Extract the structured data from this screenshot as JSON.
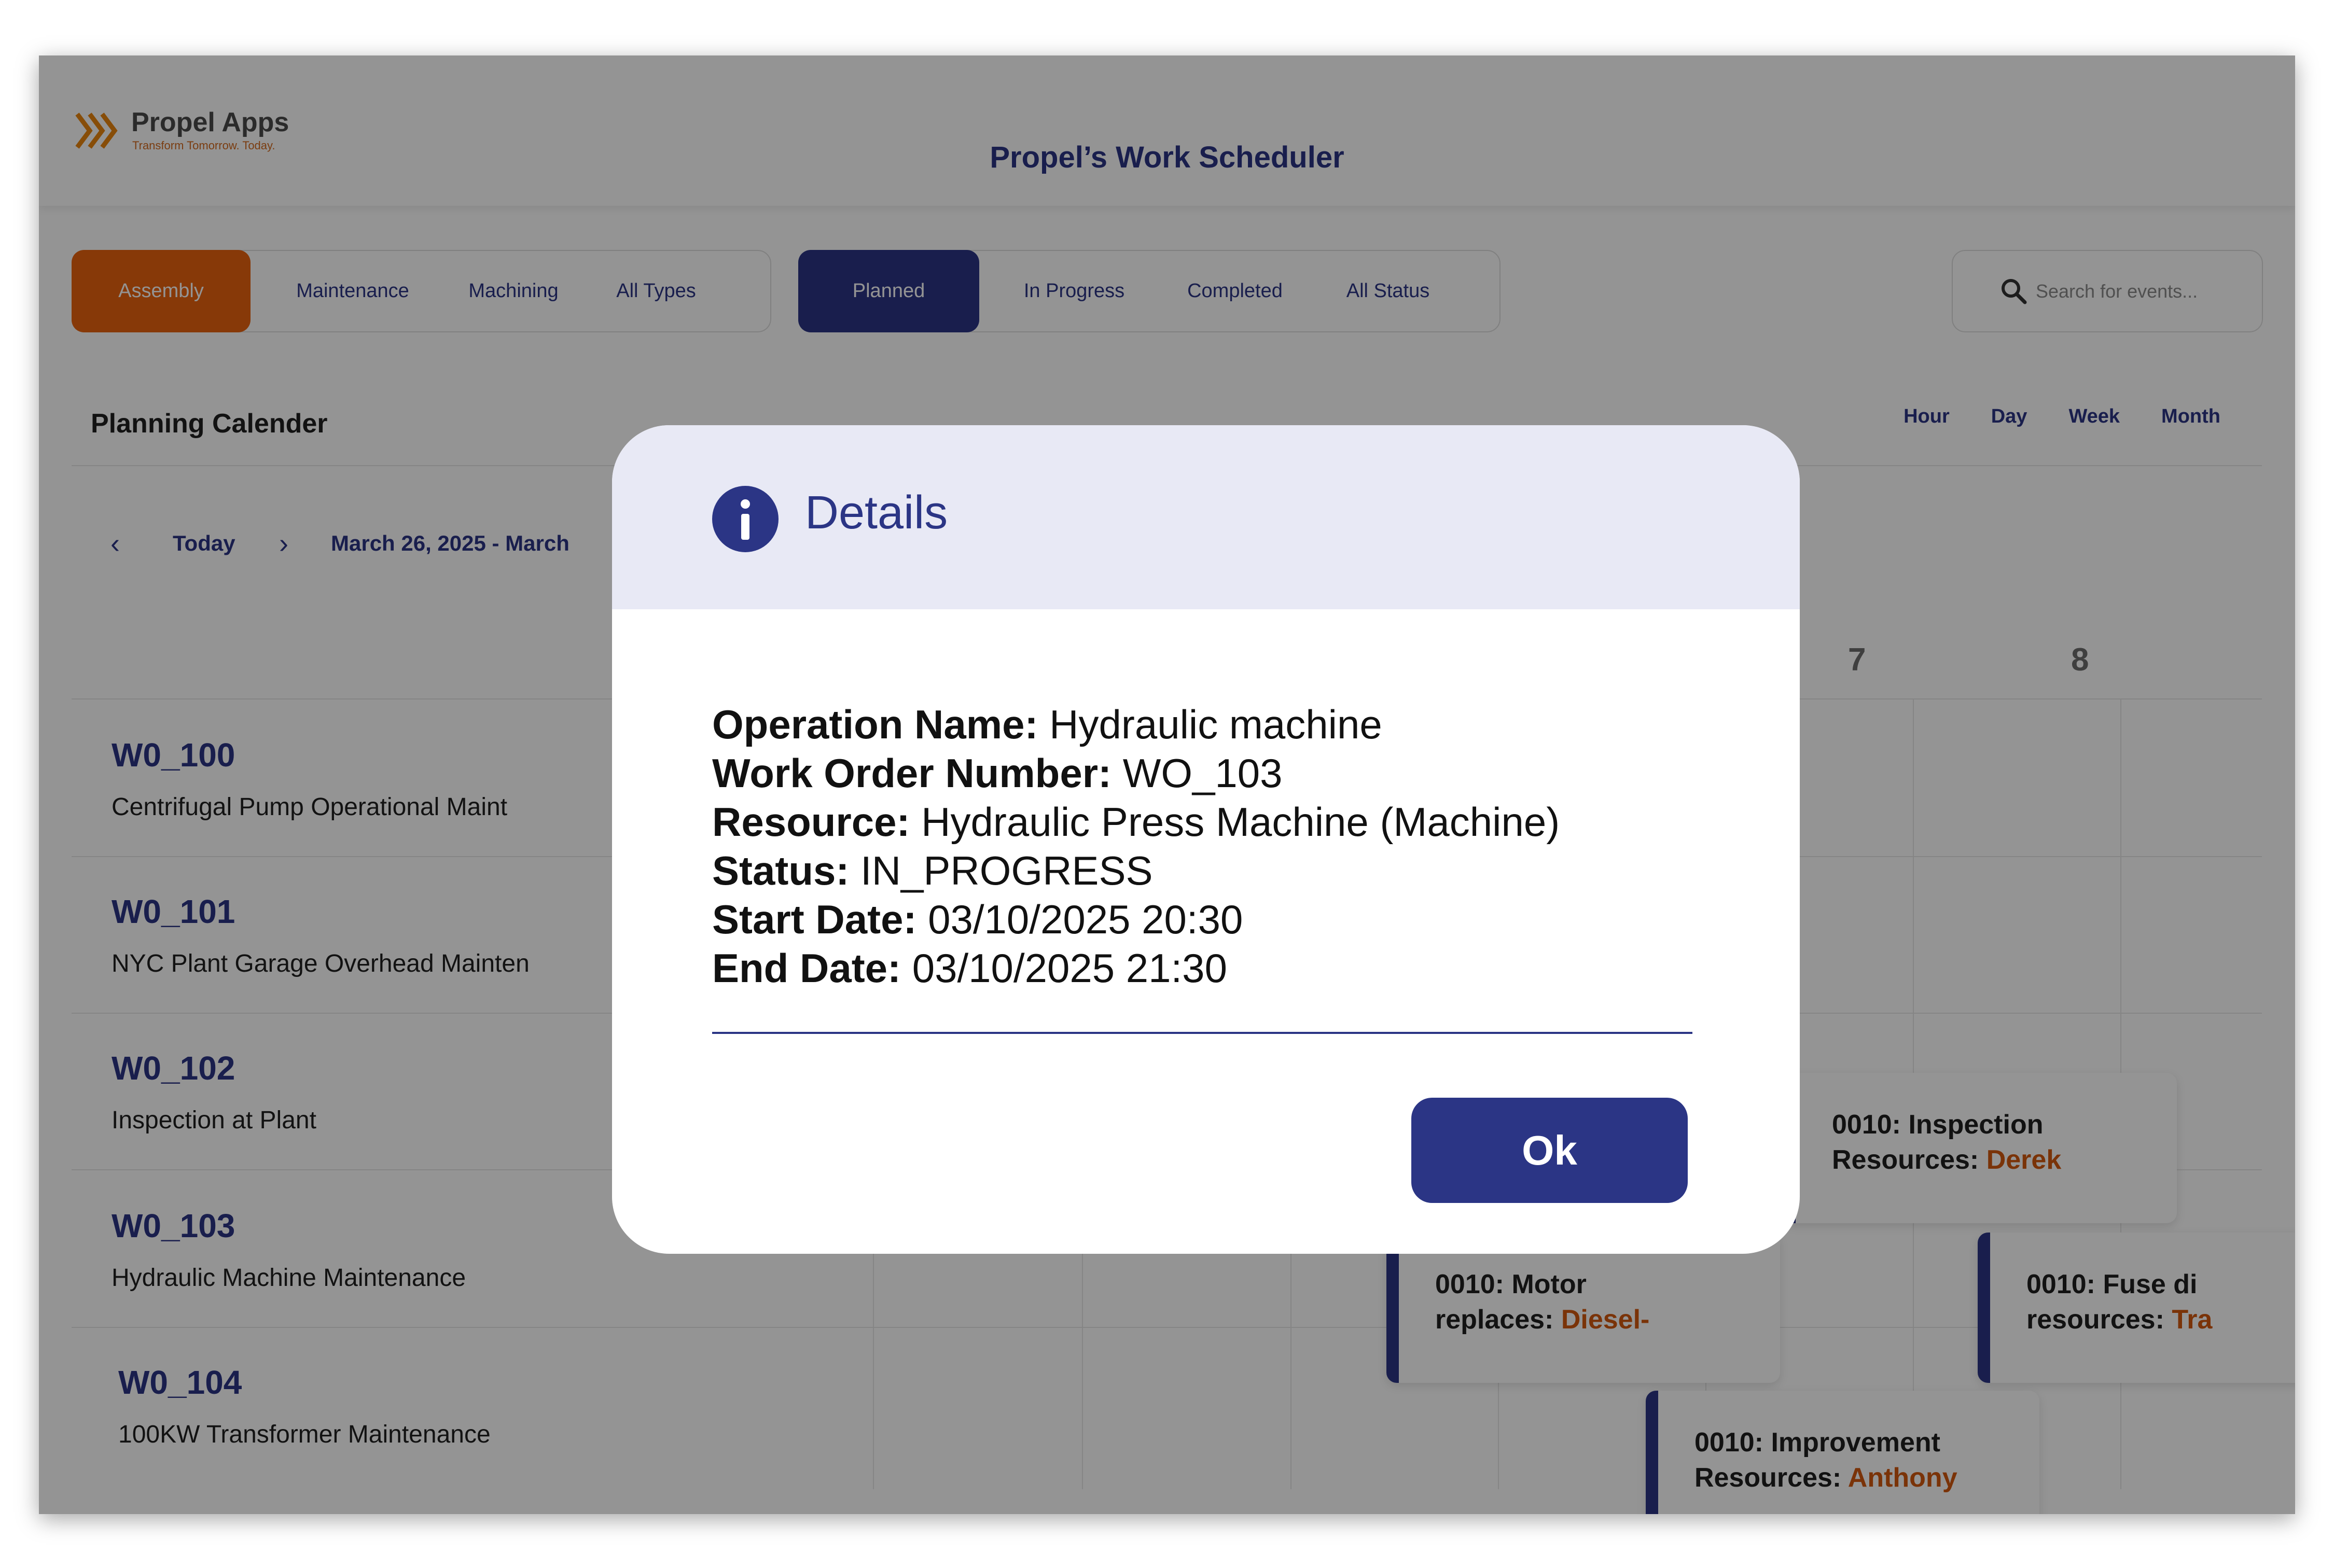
{
  "header": {
    "logo_title": "Propel Apps",
    "logo_tagline": "Transform Tomorrow. Today.",
    "app_title": "Propel’s Work Scheduler"
  },
  "type_filter": {
    "options": [
      "Assembly",
      "Maintenance",
      "Machining",
      "All Types"
    ],
    "active": "Assembly",
    "active_color": "#e8620f"
  },
  "status_filter": {
    "options": [
      "Planned",
      "In Progress",
      "Completed",
      "All Status"
    ],
    "active": "Planned",
    "active_color": "#2b3585"
  },
  "search": {
    "placeholder": "Search for events..."
  },
  "calendar": {
    "title": "Planning Calender",
    "views": [
      "Hour",
      "Day",
      "Week",
      "Month"
    ],
    "nav": {
      "today": "Today",
      "range": "March 26, 2025 - March"
    },
    "day_numbers": [
      "7",
      "8"
    ],
    "rows": [
      {
        "code": "W0_100",
        "name": "Centrifugal Pump Operational Maint"
      },
      {
        "code": "W0_101",
        "name": "NYC Plant Garage Overhead Mainten"
      },
      {
        "code": "W0_102",
        "name": "Inspection at Plant"
      },
      {
        "code": "W0_103",
        "name": "Hydraulic Machine Maintenance"
      },
      {
        "code": "W0_104",
        "name": "100KW Transformer Maintenance"
      }
    ],
    "events": [
      {
        "line1": "0010: Inspection",
        "label": "Resources:",
        "resource": "Derek"
      },
      {
        "line1": "0010: Motor",
        "label": "replaces:",
        "resource": "Diesel-"
      },
      {
        "line1": "0010: Fuse di",
        "label": "resources:",
        "resource": "Tra"
      },
      {
        "line1": "0010: Improvement",
        "label": "Resources:",
        "resource": "Anthony"
      }
    ]
  },
  "modal": {
    "title": "Details",
    "fields": [
      {
        "label": "Operation Name:",
        "value": "Hydraulic machine"
      },
      {
        "label": "Work Order Number:",
        "value": "WO_103"
      },
      {
        "label": "Resource:",
        "value": "Hydraulic Press Machine (Machine)"
      },
      {
        "label": "Status:",
        "value": "IN_PROGRESS"
      },
      {
        "label": "Start Date:",
        "value": "03/10/2025 20:30"
      },
      {
        "label": "End Date:",
        "value": "03/10/2025 21:30"
      }
    ],
    "ok_label": "Ok"
  },
  "icons": {
    "logo": "chevrons-right-icon",
    "search": "search-icon",
    "info": "info-icon",
    "prev": "chevron-left-icon",
    "next": "chevron-right-icon"
  }
}
